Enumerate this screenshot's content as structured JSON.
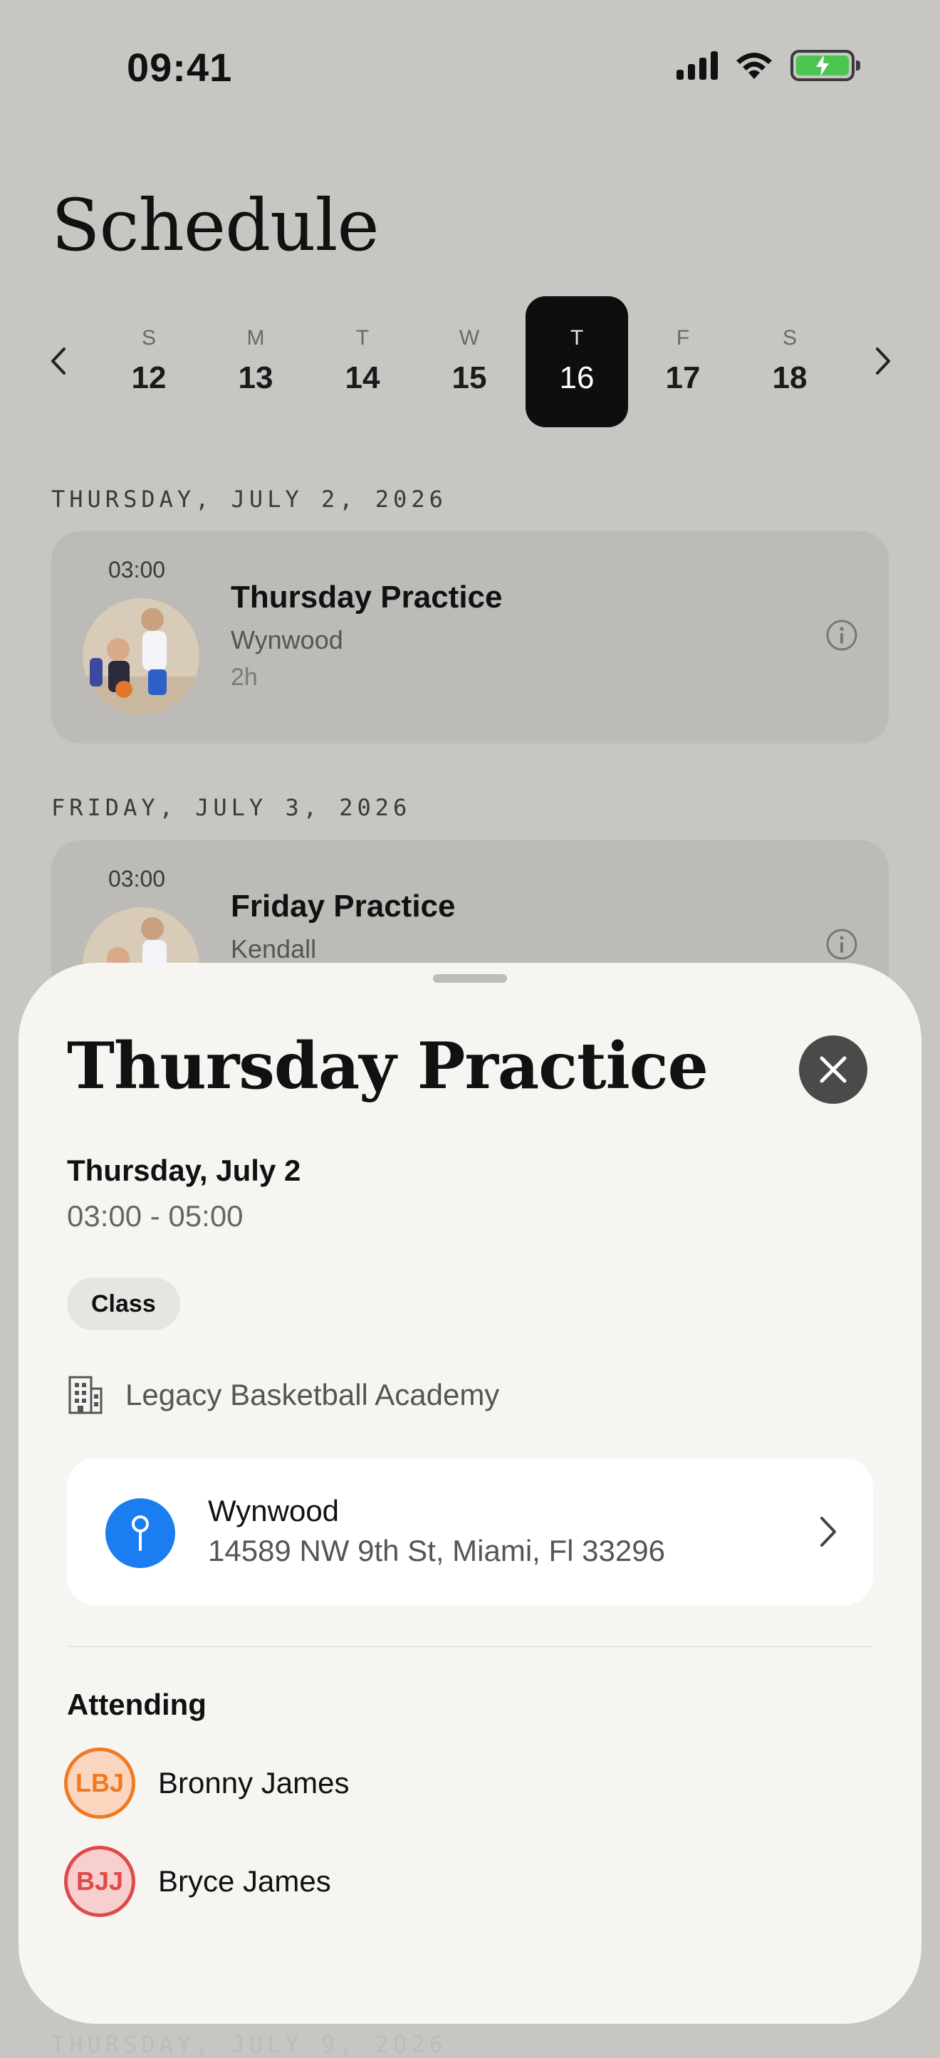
{
  "status_bar": {
    "time": "09:41"
  },
  "header": {
    "title": "Schedule"
  },
  "week": {
    "days": [
      {
        "letter": "S",
        "number": "12"
      },
      {
        "letter": "M",
        "number": "13"
      },
      {
        "letter": "T",
        "number": "14"
      },
      {
        "letter": "W",
        "number": "15"
      },
      {
        "letter": "T",
        "number": "16",
        "selected": true
      },
      {
        "letter": "F",
        "number": "17"
      },
      {
        "letter": "S",
        "number": "18"
      }
    ],
    "prev_icon": "chevron-left-icon",
    "next_icon": "chevron-right-icon"
  },
  "groups": [
    {
      "date": "THURSDAY, JULY 2, 2026",
      "event": {
        "time": "03:00",
        "name": "Thursday Practice",
        "location": "Wynwood",
        "duration": "2h"
      }
    },
    {
      "date": "FRIDAY, JULY 3, 2026",
      "event": {
        "time": "03:00",
        "name": "Friday Practice",
        "location": "Kendall"
      }
    },
    {
      "date": "THURSDAY, JULY 9, 2026"
    }
  ],
  "sheet": {
    "title": "Thursday Practice",
    "date": "Thursday, July 2",
    "time_range": "03:00 - 05:00",
    "tag": "Class",
    "organization": "Legacy Basketball Academy",
    "location": {
      "name": "Wynwood",
      "address": "14589 NW 9th St, Miami, Fl 33296"
    },
    "attending_label": "Attending",
    "attendees": [
      {
        "initials": "LBJ",
        "name": "Bronny James",
        "color": "#f07a22",
        "bg": "#fbd5bd"
      },
      {
        "initials": "BJJ",
        "name": "Bryce James",
        "color": "#e04a4a",
        "bg": "#f8cfcf"
      }
    ]
  },
  "colors": {
    "accent": "#1a7ef0",
    "selected_day": "#0e0e0e",
    "battery": "#4cc552"
  }
}
